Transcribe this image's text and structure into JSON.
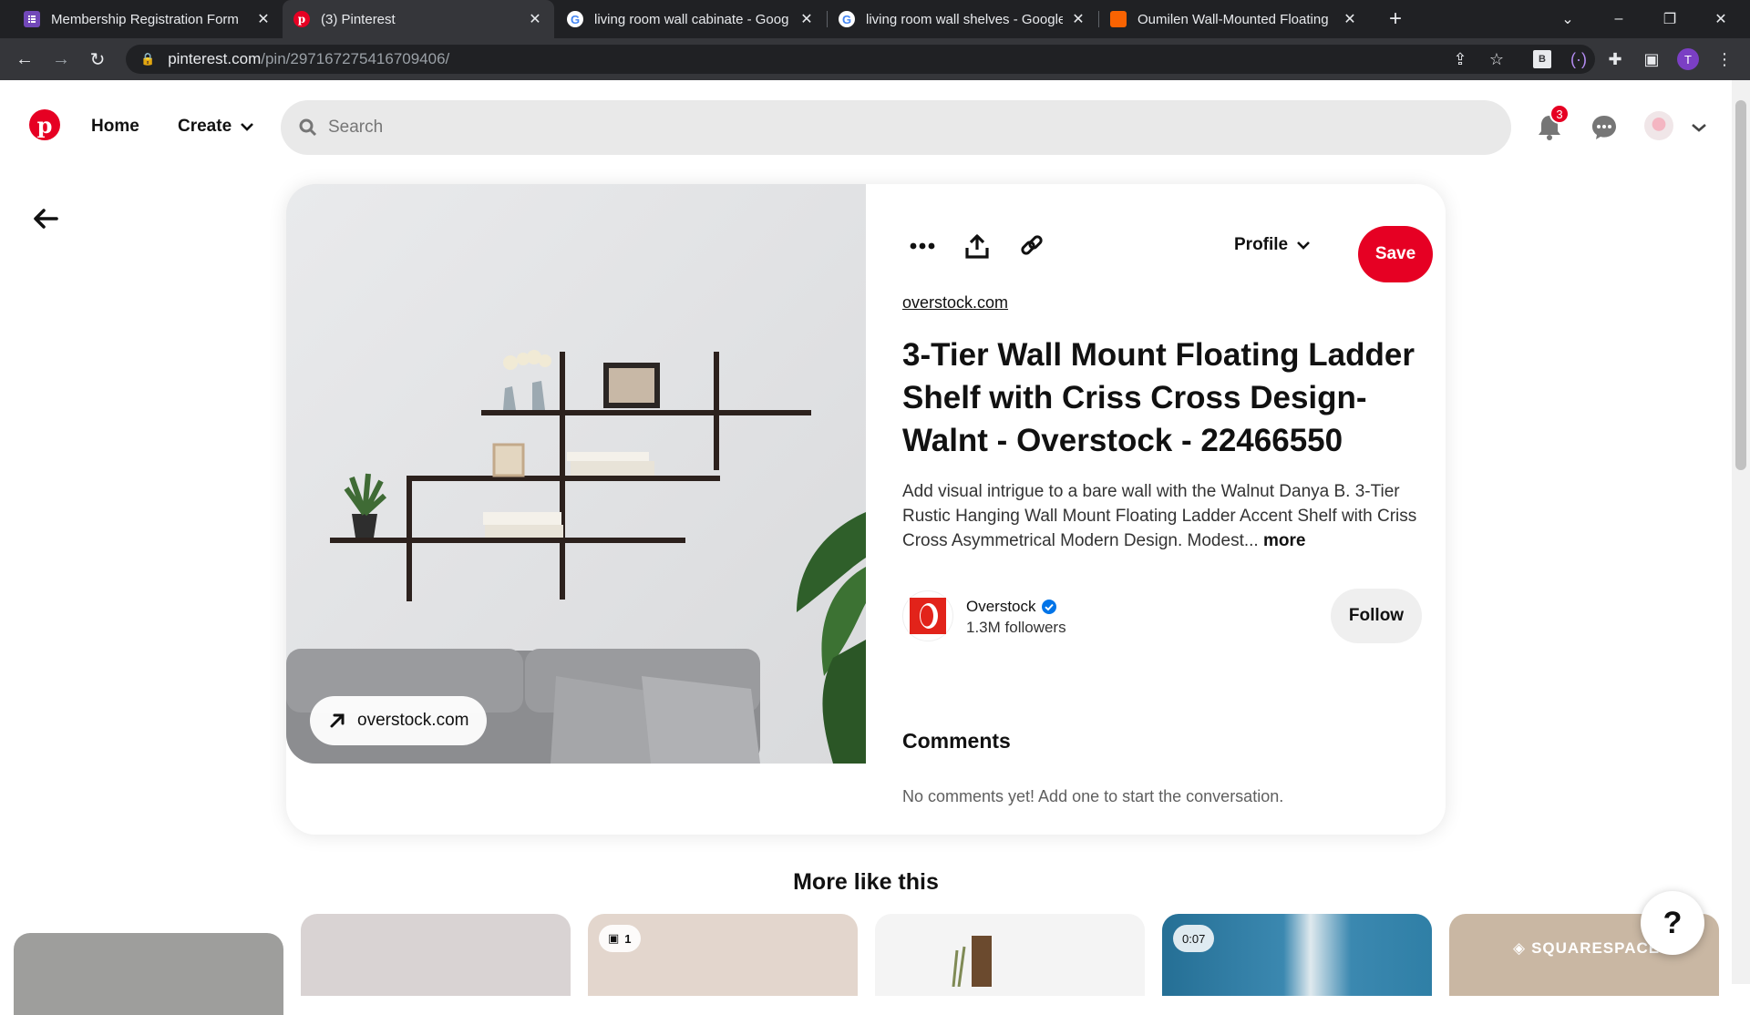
{
  "browser": {
    "tabs": [
      {
        "title": "Membership Registration Form",
        "favicon": "forms-icon",
        "color": "#7248b9"
      },
      {
        "title": "(3) Pinterest",
        "favicon": "pinterest-icon",
        "color": "#e60023"
      },
      {
        "title": "living room wall cabinate - Goog",
        "favicon": "google-icon",
        "color": "#4285f4"
      },
      {
        "title": "living room wall shelves - Google",
        "favicon": "google-icon",
        "color": "#4285f4"
      },
      {
        "title": "Oumilen Wall-Mounted Floating",
        "favicon": "homedepot-icon",
        "color": "#f96302"
      }
    ],
    "url_host": "pinterest.com",
    "url_path": "/pin/297167275416709406/",
    "profile_initial": "T"
  },
  "header": {
    "home_label": "Home",
    "create_label": "Create",
    "search_placeholder": "Search",
    "notification_count": "3"
  },
  "pin": {
    "visit_label": "overstock.com",
    "profile_label": "Profile",
    "save_label": "Save",
    "source_link": "overstock.com",
    "title": "3-Tier Wall Mount Floating Ladder Shelf with Criss Cross Design- Walnt - Overstock - 22466550",
    "description": "Add visual intrigue to a bare wall with the Walnut Danya B. 3-Tier Rustic Hanging Wall Mount Floating Ladder Accent Shelf with Criss Cross Asymmetrical Modern Design. Modest...",
    "more_label": " more",
    "creator": {
      "name": "Overstock",
      "followers": "1.3M followers",
      "verified": true
    },
    "follow_label": "Follow",
    "comments_heading": "Comments",
    "comments_empty": "No comments yet! Add one to start the conversation."
  },
  "more_like_this": {
    "heading": "More like this",
    "thumbs": [
      {
        "color": "#9e9e9c",
        "badge": ""
      },
      {
        "color": "#d9d3d3",
        "badge": ""
      },
      {
        "color": "#e3d6cd",
        "badge": "1"
      },
      {
        "color": "#f4f4f4",
        "badge": ""
      },
      {
        "color": "#2f7fa6",
        "badge": "0:07"
      },
      {
        "color": "#c9b7a3",
        "badge": "",
        "brand": "SQUARESPACE"
      }
    ]
  },
  "help_label": "?",
  "colors": {
    "brand_red": "#e60023",
    "verified_blue": "#0074e8"
  }
}
